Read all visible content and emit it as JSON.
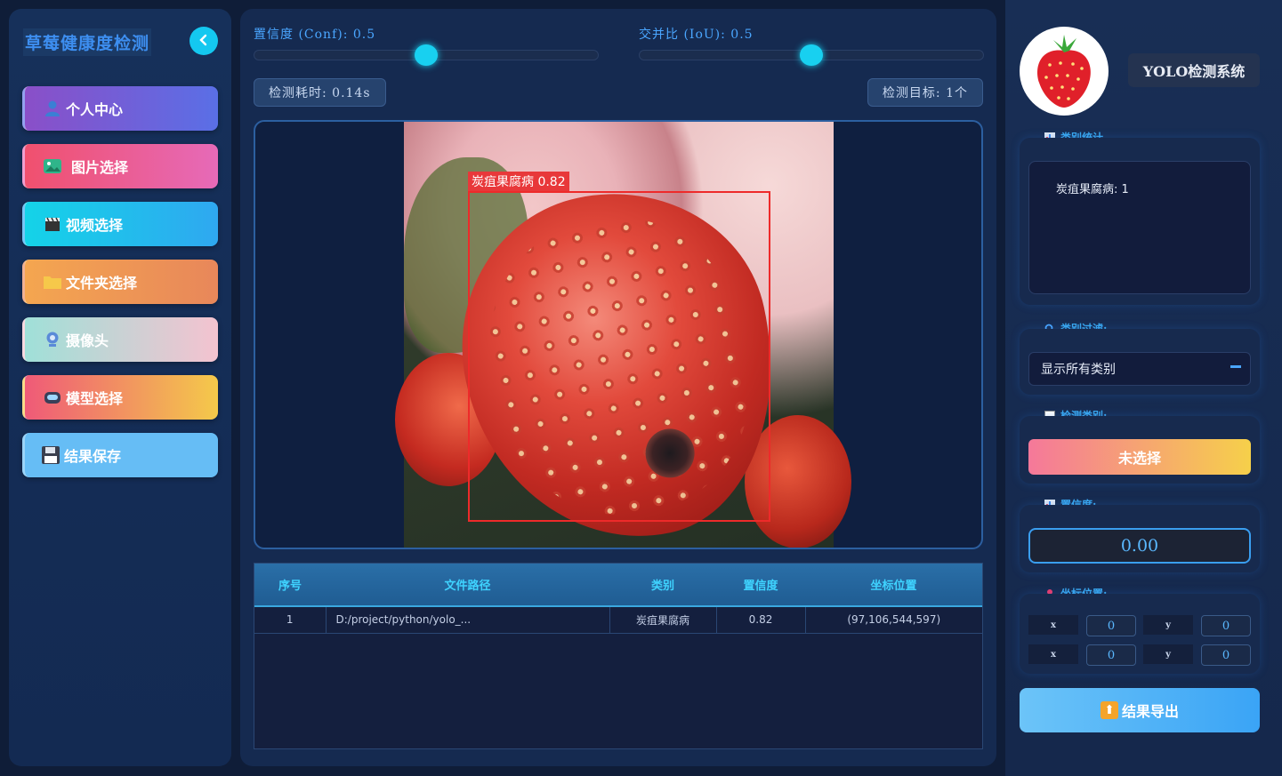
{
  "sidebar": {
    "title": "草莓健康度检测",
    "collapse_icon": "chevron-left-icon",
    "items": [
      {
        "label": "个人中心",
        "icon": "user-icon"
      },
      {
        "label": "图片选择",
        "icon": "image-icon"
      },
      {
        "label": "视频选择",
        "icon": "clapper-icon"
      },
      {
        "label": "文件夹选择",
        "icon": "folder-icon"
      },
      {
        "label": "摄像头",
        "icon": "webcam-icon"
      },
      {
        "label": "模型选择",
        "icon": "robot-icon"
      },
      {
        "label": "结果保存",
        "icon": "floppy-icon"
      }
    ]
  },
  "controls": {
    "conf_label": "置信度 (Conf): 0.5",
    "conf_value": 0.5,
    "iou_label": "交并比 (IoU): 0.5",
    "iou_value": 0.5,
    "time_text": "检测耗时: 0.14s",
    "targets_text": "检测目标: 1个"
  },
  "detection": {
    "box_label": "炭疽果腐病 0.82",
    "box_color": "#ee2a2a"
  },
  "results_table": {
    "columns": [
      "序号",
      "文件路径",
      "类别",
      "置信度",
      "坐标位置"
    ],
    "rows": [
      [
        "1",
        "D:/project/python/yolo_...",
        "炭疽果腐病",
        "0.82",
        "(97,106,544,597)"
      ]
    ]
  },
  "right_panel": {
    "system_title": "YOLO检测系统",
    "class_stats_label": "类别统计",
    "class_stats_text": "炭疽果腐病: 1",
    "filter_label": "类别过滤:",
    "filter_value": "显示所有类别",
    "detected_class_label": "检测类别:",
    "detected_class_value": "未选择",
    "confidence_label": "置信度:",
    "confidence_value": "0.00",
    "coords_label": "坐标位置:",
    "coords": {
      "x_label": "x",
      "y_label": "y",
      "x1": "0",
      "y1": "0",
      "x2": "0",
      "y2": "0"
    },
    "export_label": "结果导出"
  },
  "colors": {
    "accent": "#18d0f0",
    "background": "#0f1d38",
    "label_blue": "#3aa8f0"
  }
}
